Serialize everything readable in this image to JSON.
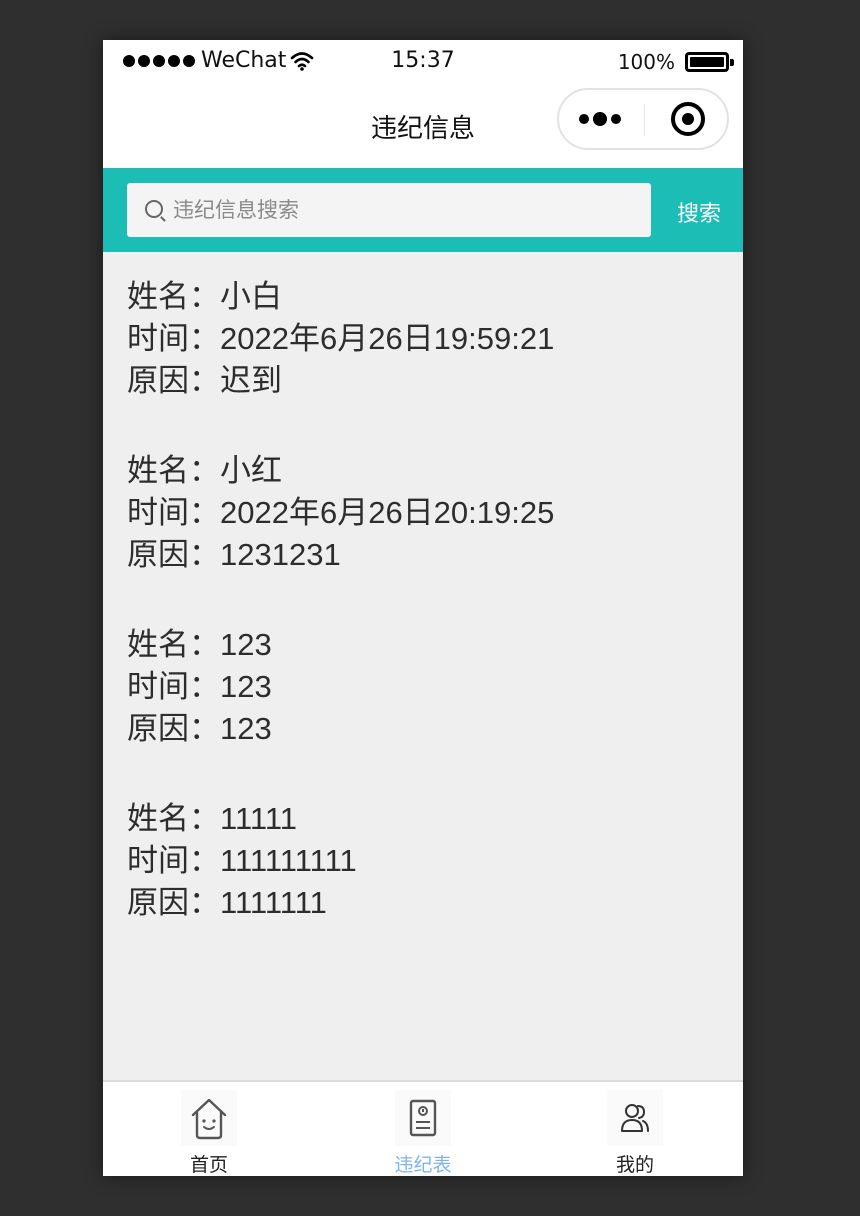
{
  "status_bar": {
    "carrier": "WeChat",
    "time": "15:37",
    "battery": "100%"
  },
  "nav": {
    "title": "违纪信息"
  },
  "search": {
    "placeholder": "违纪信息搜索",
    "value": "",
    "button_label": "搜索"
  },
  "labels": {
    "name": "姓名：",
    "time": "时间：",
    "reason": "原因："
  },
  "records": [
    {
      "name": "小白",
      "time": "2022年6月26日19:59:21",
      "reason": "迟到"
    },
    {
      "name": "小红",
      "time": "2022年6月26日20:19:25",
      "reason": "1231231"
    },
    {
      "name": "123",
      "time": "123",
      "reason": "123"
    },
    {
      "name": "11111",
      "time": "111111111",
      "reason": "1111111"
    }
  ],
  "tabs": [
    {
      "label": "首页",
      "icon": "house-face-icon",
      "active": false
    },
    {
      "label": "违纪表",
      "icon": "document-icon",
      "active": true
    },
    {
      "label": "我的",
      "icon": "users-icon",
      "active": false
    }
  ],
  "colors": {
    "search_bar_bg": "#1bbdb5",
    "active_tab": "#7eb6ec",
    "page_bg": "#efefef"
  }
}
